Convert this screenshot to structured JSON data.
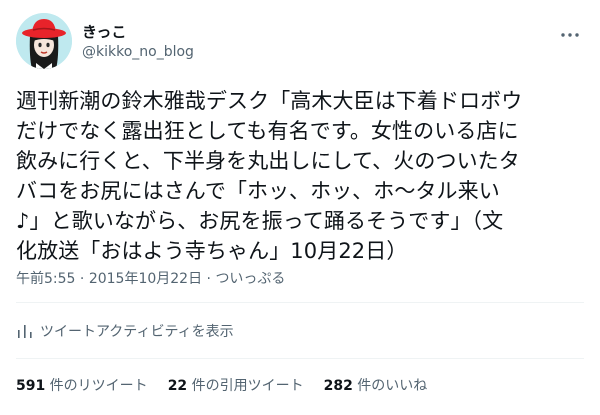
{
  "user": {
    "display_name": "きっこ",
    "handle": "@kikko_no_blog",
    "avatar_icon": "avatar-girl-red-hat"
  },
  "tweet": {
    "text": "週刊新潮の鈴木雅哉デスク「高木大臣は下着ドロボウ\nだけでなく露出狂としても有名です。女性のいる店に\n飲みに行くと、下半身を丸出しにして、火のついたタ\nバコをお尻にはさんで「ホッ、ホッ、ホ〜タル来い\n♪」と歌いながら、お尻を振って踊るそうです」（文\n化放送「おはよう寺ちゃん」10月22日）",
    "time": "午前5:55",
    "separator1": " · ",
    "date": "2015年10月22日",
    "separator2": " · ",
    "source": "ついっぷる"
  },
  "activity": {
    "label": "ツイートアクティビティを表示",
    "icon": "bar-chart-icon"
  },
  "stats": {
    "retweets_count": "591",
    "retweets_label": " 件のリツイート",
    "quotes_count": "22",
    "quotes_label": " 件の引用ツイート",
    "likes_count": "282",
    "likes_label": " 件のいいね"
  },
  "colors": {
    "text_primary": "#0f1419",
    "text_secondary": "#536471",
    "divider": "#eff3f4",
    "avatar_bg": "#bfe9ef",
    "hat_red": "#e8232a"
  }
}
